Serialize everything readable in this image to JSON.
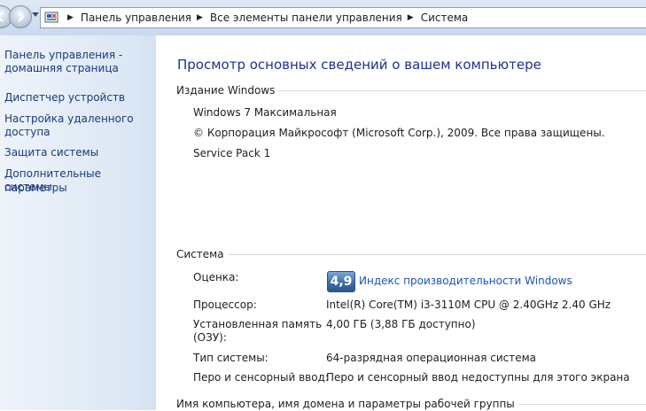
{
  "address_bar": {
    "breadcrumbs": [
      "Панель управления",
      "Все элементы панели управления",
      "Система"
    ]
  },
  "sidebar": {
    "items": [
      {
        "label": "Панель управления -"
      },
      {
        "label": "домашняя страница"
      },
      {
        "label": "Диспетчер устройств"
      },
      {
        "label": "Настройка удаленного"
      },
      {
        "label": "доступа"
      },
      {
        "label": "Защита системы"
      },
      {
        "label": "Дополнительные параметры"
      },
      {
        "label": "системы"
      }
    ]
  },
  "main": {
    "title": "Просмотр основных сведений о вашем компьютере",
    "edition": {
      "header": "Издание Windows",
      "lines": [
        "Windows 7 Максимальная",
        "© Корпорация Майкрософт (Microsoft Corp.), 2009. Все права защищены.",
        "Service Pack 1"
      ]
    },
    "system": {
      "header": "Система",
      "rating_label": "Оценка:",
      "rating_value": "4,9",
      "rating_link": "Индекс производительности Windows",
      "processor_label": "Процессор:",
      "processor_value": "Intel(R) Core(TM) i3-3110M CPU @ 2.40GHz   2.40 GHz",
      "memory_label_1": "Установленная память",
      "memory_label_2": "(ОЗУ):",
      "memory_value": "4,00 ГБ (3,88 ГБ доступно)",
      "type_label": "Тип системы:",
      "type_value": "64-разрядная операционная система",
      "pen_label": "Перо и сенсорный ввод:",
      "pen_value": "Перо и сенсорный ввод недоступны для этого экрана"
    },
    "computer_name": {
      "header": "Имя компьютера, имя домена и параметры рабочей группы"
    }
  },
  "colors": {
    "link": "#1a3a78",
    "title": "#1e3287",
    "sidebar_bg": "#dbe7f4"
  }
}
